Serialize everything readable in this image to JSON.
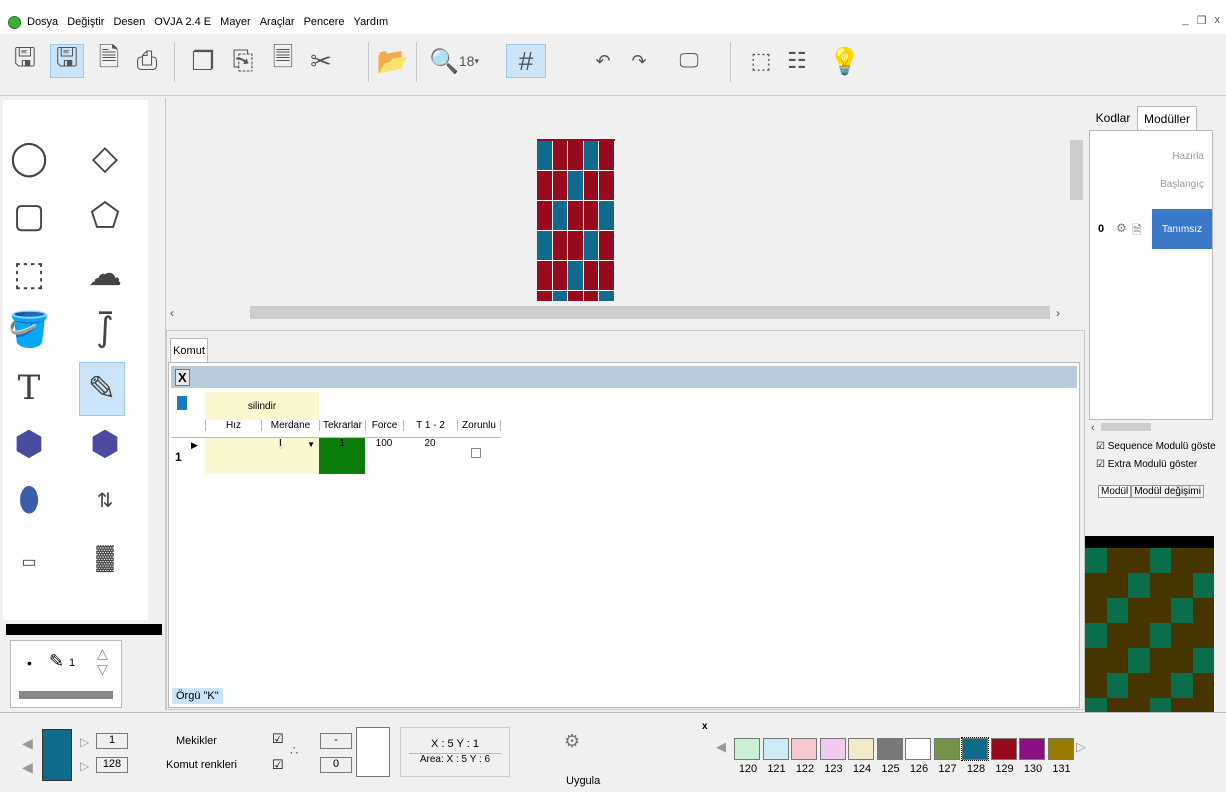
{
  "menu": {
    "items": [
      "Dosya",
      "Değiştir",
      "Desen",
      "OVJA 2.4 E",
      "Mayer",
      "Araçlar",
      "Pencere",
      "Yardım"
    ]
  },
  "toolbar": {
    "zoom": "18"
  },
  "command": {
    "tab": "Komut",
    "close": "X",
    "group_header": "silindir",
    "columns": [
      "Hız",
      "Merdane",
      "Tekrarlar",
      "Force",
      "T 1 - 2",
      "Zorunlu"
    ],
    "rows": [
      {
        "index": "1",
        "hiz": "",
        "merdane": "I",
        "tekrarlar": "1",
        "force": "100",
        "t12": "20",
        "zorunlu": false
      }
    ],
    "footer": "Örgü \"K\""
  },
  "right_panel": {
    "tabs": [
      "Kodlar",
      "Modüller"
    ],
    "active_tab": "Modüller",
    "hazirla": "Hazırla",
    "baslangic": "Başlangıç",
    "module_index": "0",
    "module_name": "Tanımsız",
    "check_sequence": "Sequence Modulü göste",
    "check_extra": "Extra Modulü göster",
    "bottom_tabs": [
      "Modül",
      "Modül değişimi"
    ]
  },
  "pen": {
    "size": "1"
  },
  "bottom": {
    "color_top": "1",
    "color_bottom": "128",
    "mekikler": "Mekikler",
    "komut_renkleri": "Komut renkleri",
    "field1": "-",
    "field2": "0",
    "coords": "X : 5  Y : 1",
    "area": "Area: X : 5  Y : 6",
    "apply": "Uygula",
    "close_x": "x"
  },
  "palette": [
    {
      "num": "120",
      "color": "#c9f0d2"
    },
    {
      "num": "121",
      "color": "#cdebf4"
    },
    {
      "num": "122",
      "color": "#f6c9cc"
    },
    {
      "num": "123",
      "color": "#f2c9ef"
    },
    {
      "num": "124",
      "color": "#f3ebc8"
    },
    {
      "num": "125",
      "color": "#787878"
    },
    {
      "num": "126",
      "color": "#ffffff"
    },
    {
      "num": "127",
      "color": "#759346"
    },
    {
      "num": "128",
      "color": "#0f6a8c"
    },
    {
      "num": "129",
      "color": "#980a1e"
    },
    {
      "num": "130",
      "color": "#8a0f84"
    },
    {
      "num": "131",
      "color": "#9b7a00"
    }
  ],
  "colors": {
    "pattern_red": "#980a1e",
    "pattern_teal": "#0f6a8c",
    "preview_bg": "#473500",
    "preview_green": "#0b6e4b",
    "selected_blue": "#3b79c8"
  }
}
